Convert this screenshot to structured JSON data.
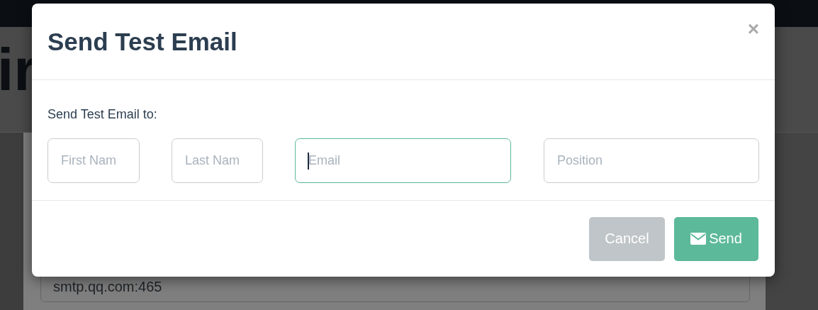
{
  "background": {
    "heading": "ir",
    "server_field": {
      "value": "smtp.qq.com:465"
    }
  },
  "modal": {
    "title": "Send Test Email",
    "close": "×",
    "label": "Send Test Email to:",
    "fields": [
      {
        "placeholder": "First Nam",
        "focused": false
      },
      {
        "placeholder": "Last Nam",
        "focused": false
      },
      {
        "placeholder": "Email",
        "focused": true
      },
      {
        "placeholder": "Position",
        "focused": false
      }
    ],
    "buttons": [
      {
        "label": "Cancel",
        "kind": "cancel"
      },
      {
        "label": "Send",
        "kind": "send"
      }
    ]
  }
}
